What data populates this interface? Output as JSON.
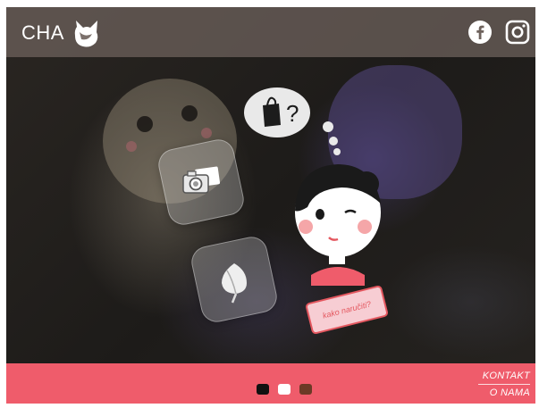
{
  "header": {
    "logo_text": "CHA",
    "social": [
      {
        "name": "facebook-icon"
      },
      {
        "name": "instagram-icon"
      }
    ]
  },
  "hero": {
    "tiles": [
      {
        "name": "camera-icon"
      },
      {
        "name": "leaf-icon"
      }
    ],
    "thought_bubble_text": "?",
    "order_tag": "kako naručiti?"
  },
  "footer": {
    "background_color": "#ef5c6b",
    "dot_colors": [
      "#111111",
      "#ffffff",
      "#6b3a26"
    ],
    "links": {
      "kontakt": "KONTAKT",
      "o_nama": "O NAMA"
    }
  }
}
